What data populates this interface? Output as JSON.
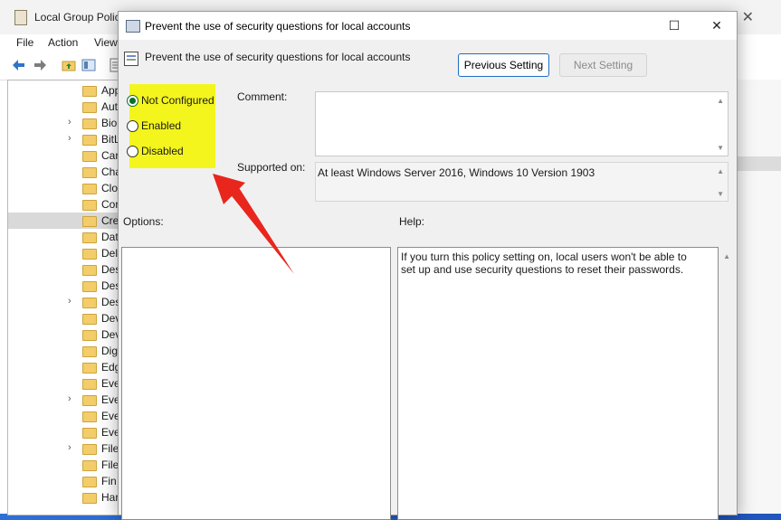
{
  "background_window": {
    "title": "Local Group Polic",
    "close_glyph": "✕",
    "menu": [
      "File",
      "Action",
      "View"
    ],
    "tree_items": [
      {
        "label": "App",
        "expandable": false,
        "selected": false
      },
      {
        "label": "Aut",
        "expandable": false,
        "selected": false
      },
      {
        "label": "Bio",
        "expandable": true,
        "selected": false
      },
      {
        "label": "BitL",
        "expandable": true,
        "selected": false
      },
      {
        "label": "Car",
        "expandable": false,
        "selected": false
      },
      {
        "label": "Cha",
        "expandable": false,
        "selected": false
      },
      {
        "label": "Clo",
        "expandable": false,
        "selected": false
      },
      {
        "label": "Cor",
        "expandable": false,
        "selected": false
      },
      {
        "label": "Cre",
        "expandable": false,
        "selected": true
      },
      {
        "label": "Dat",
        "expandable": false,
        "selected": false
      },
      {
        "label": "Deli",
        "expandable": false,
        "selected": false
      },
      {
        "label": "Des",
        "expandable": false,
        "selected": false
      },
      {
        "label": "Des",
        "expandable": false,
        "selected": false
      },
      {
        "label": "Des",
        "expandable": true,
        "selected": false
      },
      {
        "label": "Dev",
        "expandable": false,
        "selected": false
      },
      {
        "label": "Dev",
        "expandable": false,
        "selected": false
      },
      {
        "label": "Dig",
        "expandable": false,
        "selected": false
      },
      {
        "label": "Edg",
        "expandable": false,
        "selected": false
      },
      {
        "label": "Eve",
        "expandable": false,
        "selected": false
      },
      {
        "label": "Eve",
        "expandable": true,
        "selected": false
      },
      {
        "label": "Eve",
        "expandable": false,
        "selected": false
      },
      {
        "label": "Eve",
        "expandable": false,
        "selected": false
      },
      {
        "label": "File",
        "expandable": true,
        "selected": false
      },
      {
        "label": "File",
        "expandable": false,
        "selected": false
      },
      {
        "label": "Fin",
        "expandable": false,
        "selected": false
      },
      {
        "label": "Har",
        "expandable": false,
        "selected": false
      }
    ]
  },
  "dialog": {
    "title": "Prevent the use of security questions for local accounts",
    "maximize_glyph": "☐",
    "close_glyph": "✕",
    "header_title": "Prevent the use of security questions for local accounts",
    "prev_button": "Previous Setting",
    "next_button": "Next Setting",
    "radios": [
      {
        "label": "Not Configured",
        "checked": true
      },
      {
        "label": "Enabled",
        "checked": false
      },
      {
        "label": "Disabled",
        "checked": false
      }
    ],
    "comment_label": "Comment:",
    "comment_value": "",
    "supported_label": "Supported on:",
    "supported_value": "At least Windows Server 2016, Windows 10 Version 1903",
    "options_label": "Options:",
    "help_label": "Help:",
    "help_text": "If you turn this policy setting on, local users won't be able to set up and use security questions to reset their passwords."
  },
  "colors": {
    "highlight": "#f3f51d",
    "annotation_arrow": "#e8261e",
    "accent_button_border": "#1f6fc5",
    "radio_checked": "#0b6e2d"
  }
}
